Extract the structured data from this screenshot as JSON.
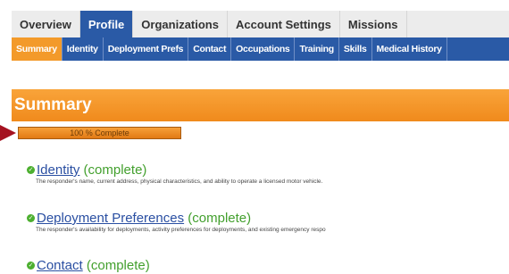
{
  "top_tabs": [
    "Overview",
    "Profile",
    "Organizations",
    "Account Settings",
    "Missions"
  ],
  "top_tabs_active": "Profile",
  "sub_tabs": [
    "Summary",
    "Identity",
    "Deployment Prefs",
    "Contact",
    "Occupations",
    "Training",
    "Skills",
    "Medical History"
  ],
  "sub_tabs_active": "Summary",
  "summary": {
    "title": "Summary",
    "progress_label": "100 % Complete",
    "progress_value": 1.0
  },
  "sections": [
    {
      "title": "Identity",
      "status": "(complete)",
      "description": "The responder's name, current address, physical characteristics, and ability to operate a licensed motor vehicle."
    },
    {
      "title": "Deployment Preferences",
      "status": "(complete)",
      "description": "The responder's availability for deployments, activity preferences for deployments, and existing emergency respo"
    },
    {
      "title": "Contact",
      "status": "(complete)",
      "description": ""
    }
  ],
  "colors": {
    "tab_blue": "#2a5aa6",
    "accent_orange": "#f39a2a",
    "complete_green": "#43a02e",
    "arrow_red": "#a51220"
  }
}
